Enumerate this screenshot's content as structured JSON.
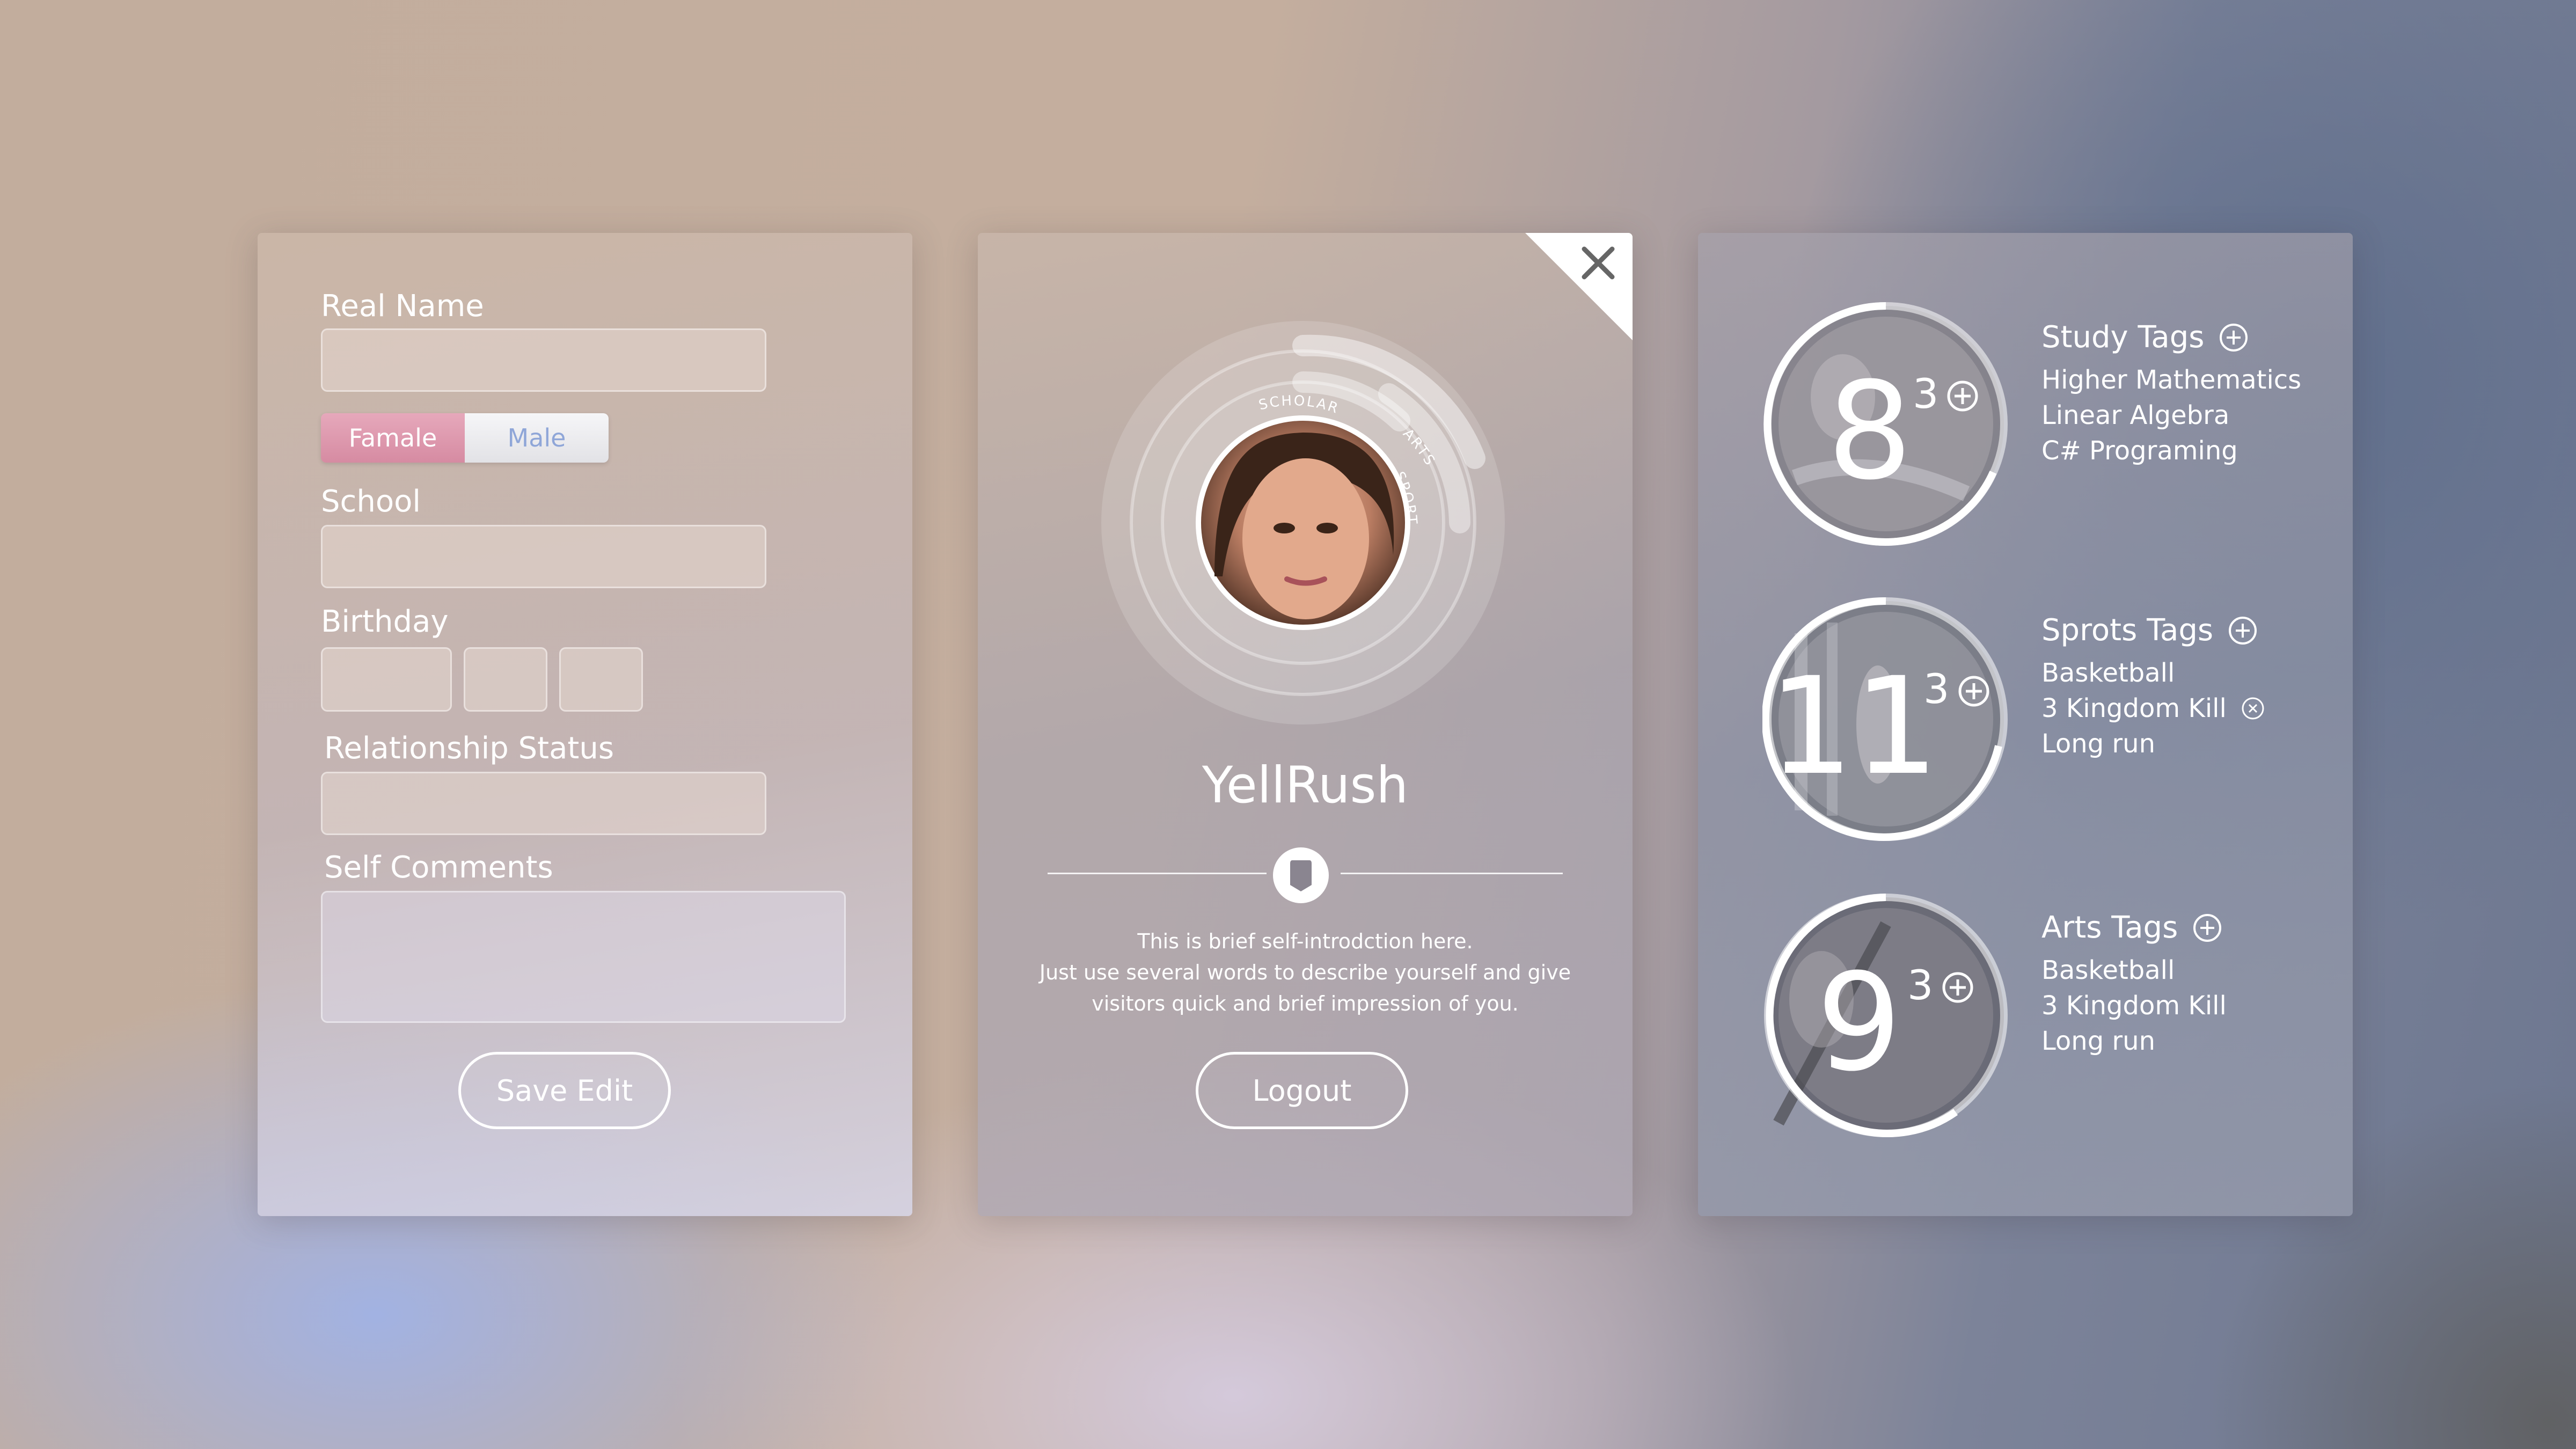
{
  "profile_form": {
    "real_name_label": "Real Name",
    "gender": {
      "female": "Famale",
      "male": "Male",
      "selected": "Famale"
    },
    "school_label": "School",
    "birthday_label": "Birthday",
    "relationship_label": "Relationship Status",
    "comments_label": "Self Comments",
    "save_button": "Save Edit"
  },
  "profile_card": {
    "username": "YellRush",
    "ring_labels": [
      "SCHOLAR",
      "ARTS",
      "SPORTS"
    ],
    "intro": [
      "This is brief self-introdction here.",
      "Just use several words to describe yourself and give",
      "visitors quick and brief impression of you."
    ],
    "logout_button": "Logout"
  },
  "tags": {
    "study": {
      "title": "Study Tags",
      "count": "8",
      "extra": "3",
      "items": [
        "Higher Mathematics",
        "Linear Algebra",
        "C# Programing"
      ]
    },
    "sports": {
      "title": "Sprots Tags",
      "count": "11",
      "extra": "3",
      "items": [
        "Basketball",
        "3 Kingdom Kill",
        "Long run"
      ]
    },
    "arts": {
      "title": "Arts Tags",
      "count": "9",
      "extra": "3",
      "items": [
        "Basketball",
        "3 Kingdom Kill",
        "Long run"
      ]
    }
  },
  "colors": {
    "female_pill": "#d68ba2",
    "male_text": "#8fa6d8",
    "text": "#ffffff"
  }
}
